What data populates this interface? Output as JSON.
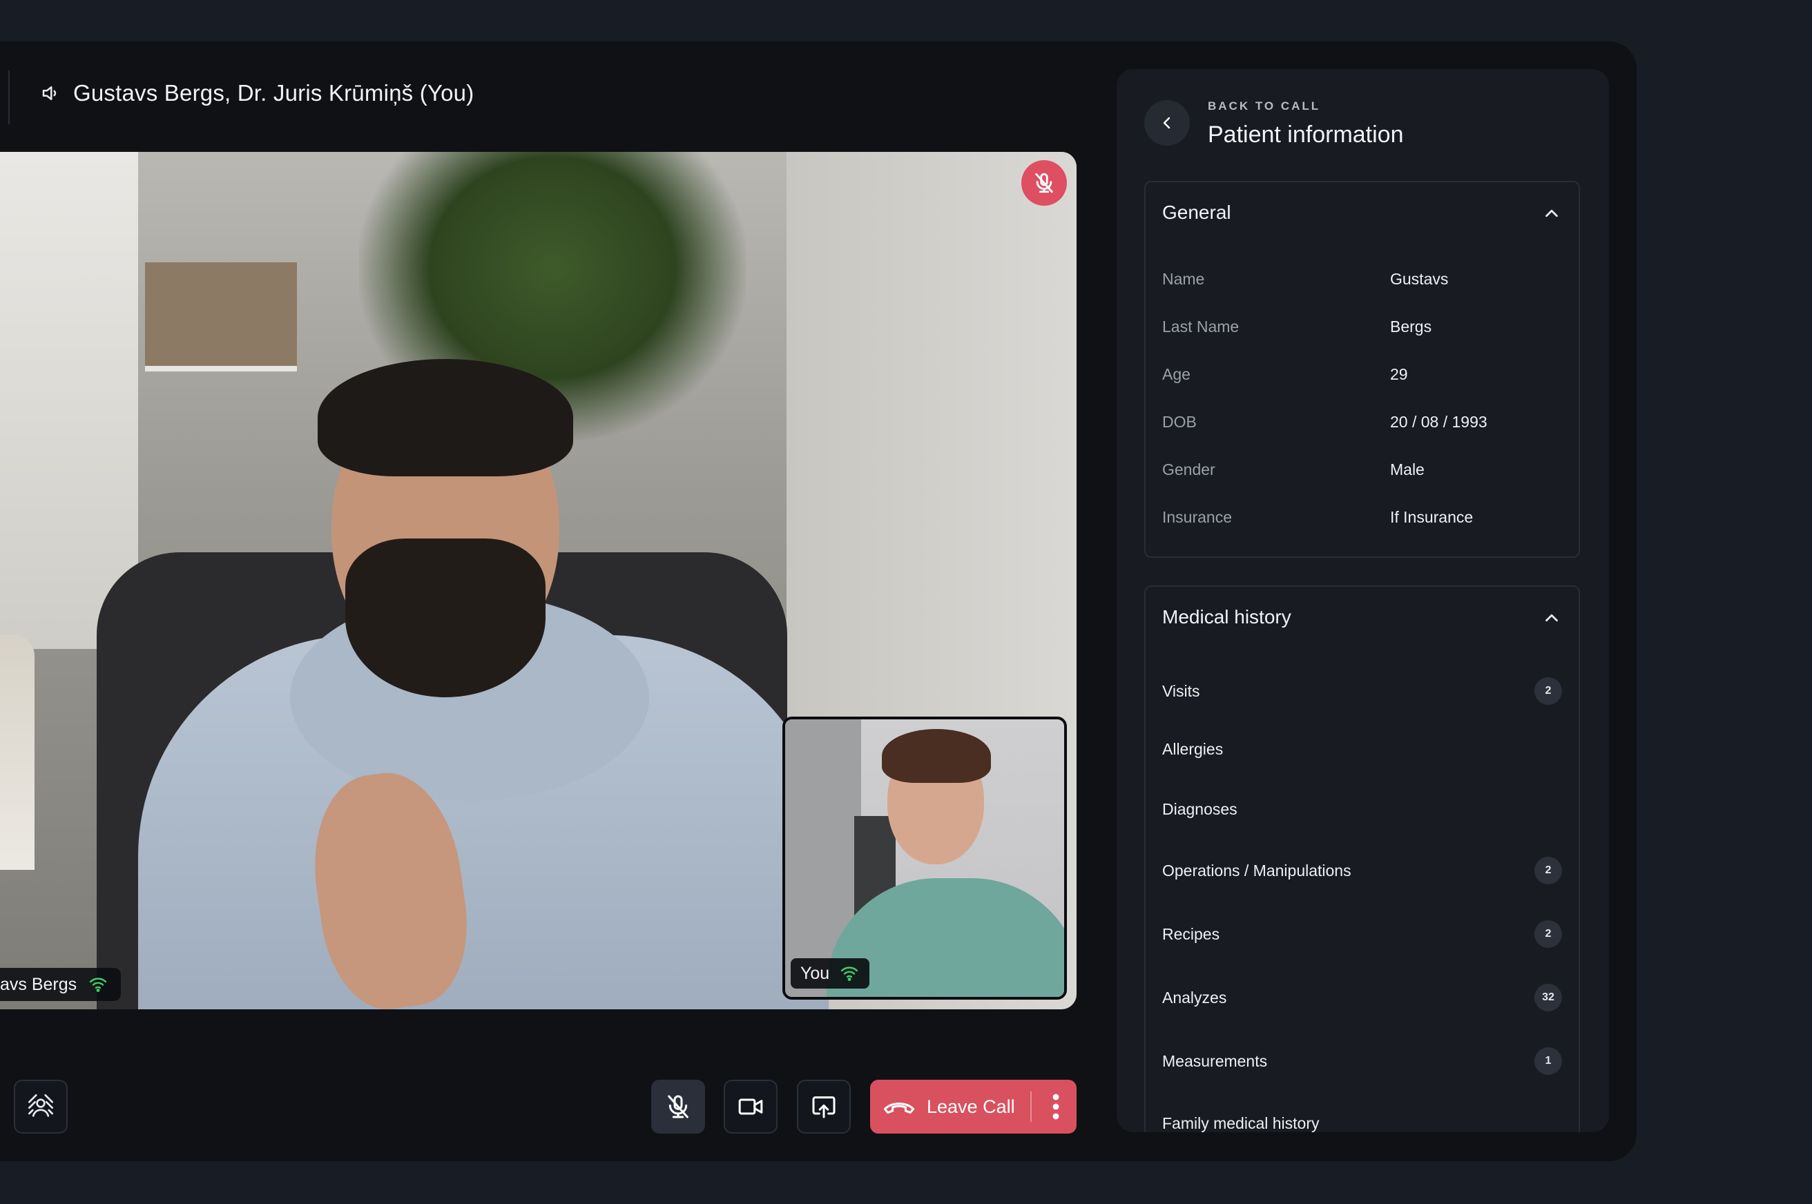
{
  "call": {
    "participants_title": "Gustavs Bergs, Dr. Juris Krūmiņš (You)",
    "remote_name_tag": "avs Bergs",
    "self_tag": "You"
  },
  "controls": {
    "leave_label": "Leave Call"
  },
  "panel": {
    "back_caption": "BACK TO CALL",
    "title": "Patient information",
    "general": {
      "heading": "General",
      "rows": [
        {
          "key": "Name",
          "value": "Gustavs"
        },
        {
          "key": "Last Name",
          "value": "Bergs"
        },
        {
          "key": "Age",
          "value": "29"
        },
        {
          "key": "DOB",
          "value": "20 / 08 / 1993"
        },
        {
          "key": "Gender",
          "value": "Male"
        },
        {
          "key": "Insurance",
          "value": "If Insurance"
        }
      ]
    },
    "medical_history": {
      "heading": "Medical history",
      "items": [
        {
          "label": "Visits",
          "count": "2"
        },
        {
          "label": "Allergies",
          "count": ""
        },
        {
          "label": "Diagnoses",
          "count": ""
        },
        {
          "label": "Operations / Manipulations",
          "count": "2"
        },
        {
          "label": "Recipes",
          "count": "2"
        },
        {
          "label": "Analyzes",
          "count": "32"
        },
        {
          "label": "Measurements",
          "count": "1"
        },
        {
          "label": "Family medical history",
          "count": ""
        }
      ]
    }
  },
  "colors": {
    "accent_red": "#de4f62",
    "wifi_green": "#3ecf6b",
    "panel_bg": "#181b21",
    "app_bg": "#0f1115"
  },
  "icons": [
    "speaker-icon",
    "mic-off-icon",
    "wifi-icon",
    "background-blur-icon",
    "camera-icon",
    "share-screen-icon",
    "phone-hangup-icon",
    "more-vertical-icon",
    "chevron-left-icon",
    "chevron-up-icon"
  ]
}
